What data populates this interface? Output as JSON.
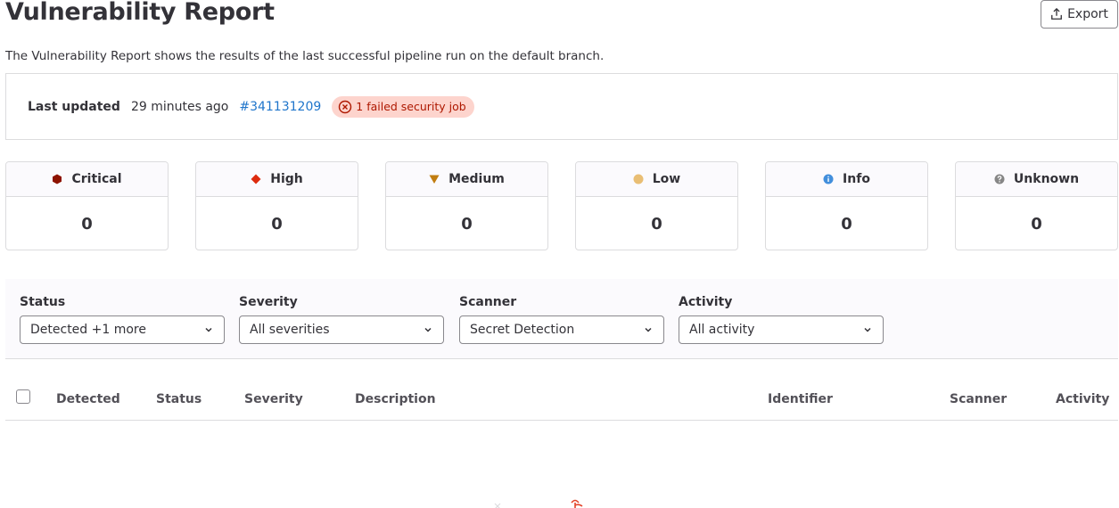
{
  "header": {
    "title": "Vulnerability Report",
    "export_label": "Export",
    "description": "The Vulnerability Report shows the results of the last successful pipeline run on the default branch."
  },
  "status": {
    "last_updated_label": "Last updated",
    "time_ago": "29 minutes ago",
    "pipeline_link": "#341131209",
    "failed_badge": "1 failed security job"
  },
  "severities": [
    {
      "label": "Critical",
      "count": "0",
      "icon": "critical-hexagon-icon",
      "color": "#8d1300"
    },
    {
      "label": "High",
      "count": "0",
      "icon": "high-diamond-icon",
      "color": "#dd2b0e"
    },
    {
      "label": "Medium",
      "count": "0",
      "icon": "medium-triangle-icon",
      "color": "#c17d10"
    },
    {
      "label": "Low",
      "count": "0",
      "icon": "low-circle-icon",
      "color": "#e9be74"
    },
    {
      "label": "Info",
      "count": "0",
      "icon": "info-circle-icon",
      "color": "#428fdc"
    },
    {
      "label": "Unknown",
      "count": "0",
      "icon": "unknown-question-icon",
      "color": "#868686"
    }
  ],
  "filters": {
    "status": {
      "label": "Status",
      "value": "Detected +1 more"
    },
    "severity": {
      "label": "Severity",
      "value": "All severities"
    },
    "scanner": {
      "label": "Scanner",
      "value": "Secret Detection"
    },
    "activity": {
      "label": "Activity",
      "value": "All activity"
    }
  },
  "table": {
    "columns": [
      "Detected",
      "Status",
      "Severity",
      "Description",
      "Identifier",
      "Scanner",
      "Activity"
    ]
  },
  "colors": {
    "link": "#1f75cb",
    "danger_bg": "#fdd4cd",
    "danger_text": "#ae1800"
  }
}
